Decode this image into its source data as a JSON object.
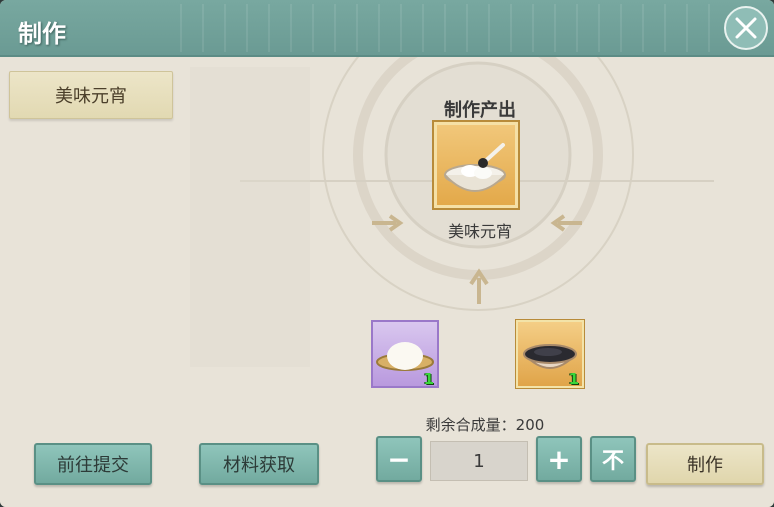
{
  "window": {
    "title": "制作"
  },
  "recipe_list": {
    "items": [
      {
        "label": "美味元宵",
        "selected": true
      }
    ]
  },
  "output": {
    "section_label": "制作产出",
    "item_name": "美味元宵",
    "icon": "sweet-dumpling-bowl-icon"
  },
  "materials": [
    {
      "icon": "white-dough-ball-icon",
      "quantity": "1",
      "rarity_color": "#b999de"
    },
    {
      "icon": "black-sesame-filling-icon",
      "quantity": "1",
      "rarity_color": "#e0a449"
    }
  ],
  "remaining": {
    "label": "剩余合成量：200"
  },
  "controls": {
    "goto_submit_label": "前往提交",
    "get_materials_label": "材料获取",
    "minus_symbol": "−",
    "count_value": "1",
    "plus_symbol": "+",
    "max_symbol": "不",
    "make_label": "制作"
  },
  "colors": {
    "accent": "#72aa9f",
    "title_bar": "#6a9a93",
    "gold": "#e3a94a"
  }
}
